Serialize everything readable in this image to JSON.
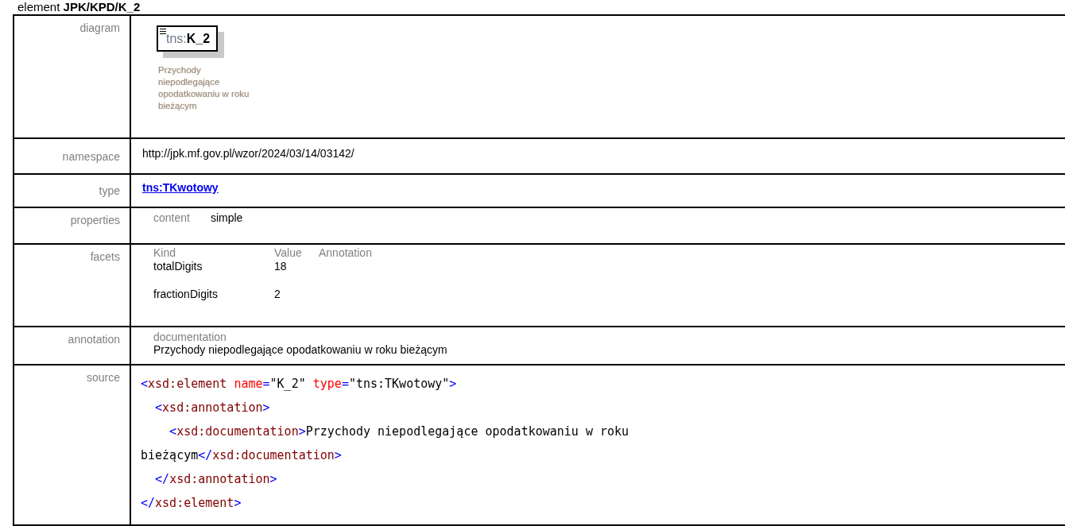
{
  "heading": "element **JPK/KPD/K_2**",
  "diagram": {
    "label": "diagram",
    "prefix": "tns:",
    "name": "K_2",
    "description": "Przychody niepodlegające opodatkowaniu w roku bieżącym"
  },
  "namespace": {
    "label": "namespace",
    "value": "http://jpk.mf.gov.pl/wzor/2024/03/14/03142/"
  },
  "type": {
    "label": "type",
    "link": "tns:TKwotowy"
  },
  "properties": {
    "label": "properties",
    "name": "content",
    "value": "simple"
  },
  "facets": {
    "label": "facets",
    "columns": [
      "Kind",
      "Value",
      "Annotation"
    ],
    "rows": [
      {
        "kind": "totalDigits",
        "value": "18"
      },
      {
        "kind": "fractionDigits",
        "value": "2"
      }
    ]
  },
  "annotation": {
    "label": "annotation",
    "name": "documentation",
    "text": "Przychody niepodlegające opodatkowaniu w roku bieżącym"
  },
  "source": {
    "label": "source",
    "lines": [
      [
        {
          "kind": "punct",
          "text": "<"
        },
        {
          "kind": "tag",
          "text": "xsd:element"
        },
        {
          "kind": "attr",
          "text": " name"
        },
        {
          "kind": "punct",
          "text": "="
        },
        {
          "kind": "value",
          "text": "\"K_2\""
        },
        {
          "kind": "attr",
          "text": " type"
        },
        {
          "kind": "punct",
          "text": "="
        },
        {
          "kind": "value",
          "text": "\"tns:TKwotowy\""
        },
        {
          "kind": "punct",
          "text": ">"
        }
      ],
      [
        {
          "kind": "punct",
          "text": "  <"
        },
        {
          "kind": "tag",
          "text": "xsd:annotation"
        },
        {
          "kind": "punct",
          "text": ">"
        }
      ],
      [
        {
          "kind": "punct",
          "text": "    <"
        },
        {
          "kind": "tag",
          "text": "xsd:documentation"
        },
        {
          "kind": "punct",
          "text": ">"
        },
        {
          "kind": "text",
          "text": "Przychody niepodlegające opodatkowaniu w roku"
        }
      ],
      [
        {
          "kind": "text",
          "text": "bieżącym"
        },
        {
          "kind": "punct",
          "text": "</"
        },
        {
          "kind": "tag",
          "text": "xsd:documentation"
        },
        {
          "kind": "punct",
          "text": ">"
        }
      ],
      [
        {
          "kind": "punct",
          "text": "  </"
        },
        {
          "kind": "tag",
          "text": "xsd:annotation"
        },
        {
          "kind": "punct",
          "text": ">"
        }
      ],
      [
        {
          "kind": "punct",
          "text": "</"
        },
        {
          "kind": "tag",
          "text": "xsd:element"
        },
        {
          "kind": "punct",
          "text": ">"
        }
      ]
    ]
  }
}
